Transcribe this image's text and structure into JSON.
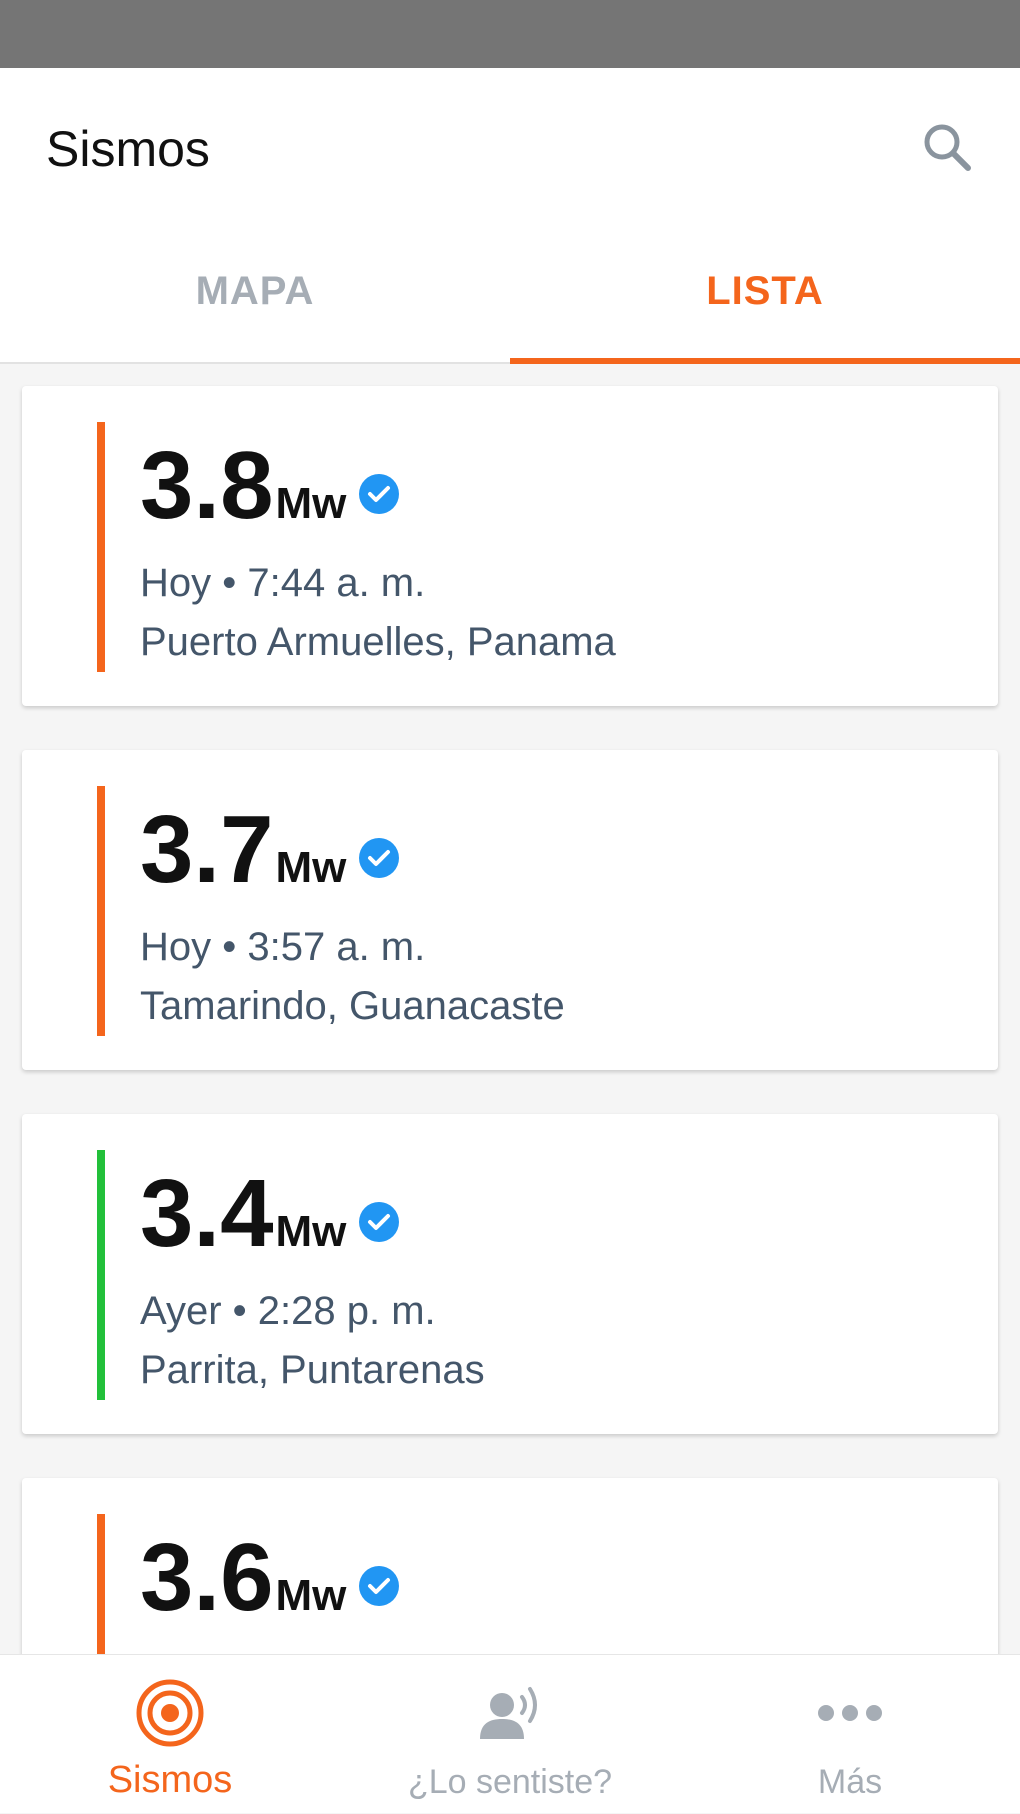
{
  "colors": {
    "accent": "#f4651c",
    "status_bar": "#757575",
    "verified_blue": "#2196f3",
    "inactive_gray": "#a6adb5",
    "bar_orange": "#f4651c",
    "bar_green": "#22c03a"
  },
  "appbar": {
    "title": "Sismos",
    "search_icon": "search-icon"
  },
  "tabs": [
    {
      "label": "MAPA",
      "selected": false
    },
    {
      "label": "LISTA",
      "selected": true
    }
  ],
  "quakes": [
    {
      "magnitude": "3.8",
      "unit": "Mw",
      "verified": true,
      "time": "Hoy • 7:44 a. m.",
      "place": "Puerto Armuelles, Panama",
      "bar_color": "#f4651c"
    },
    {
      "magnitude": "3.7",
      "unit": "Mw",
      "verified": true,
      "time": "Hoy • 3:57 a. m.",
      "place": "Tamarindo, Guanacaste",
      "bar_color": "#f4651c"
    },
    {
      "magnitude": "3.4",
      "unit": "Mw",
      "verified": true,
      "time": "Ayer • 2:28 p. m.",
      "place": "Parrita, Puntarenas",
      "bar_color": "#22c03a"
    },
    {
      "magnitude": "3.6",
      "unit": "Mw",
      "verified": true,
      "time": "",
      "place": "",
      "bar_color": "#f4651c"
    }
  ],
  "bottom_nav": [
    {
      "label": "Sismos",
      "icon": "target-icon",
      "active": true
    },
    {
      "label": "¿Lo sentiste?",
      "icon": "person-speaking-icon",
      "active": false
    },
    {
      "label": "Más",
      "icon": "more-dots-icon",
      "active": false
    }
  ]
}
